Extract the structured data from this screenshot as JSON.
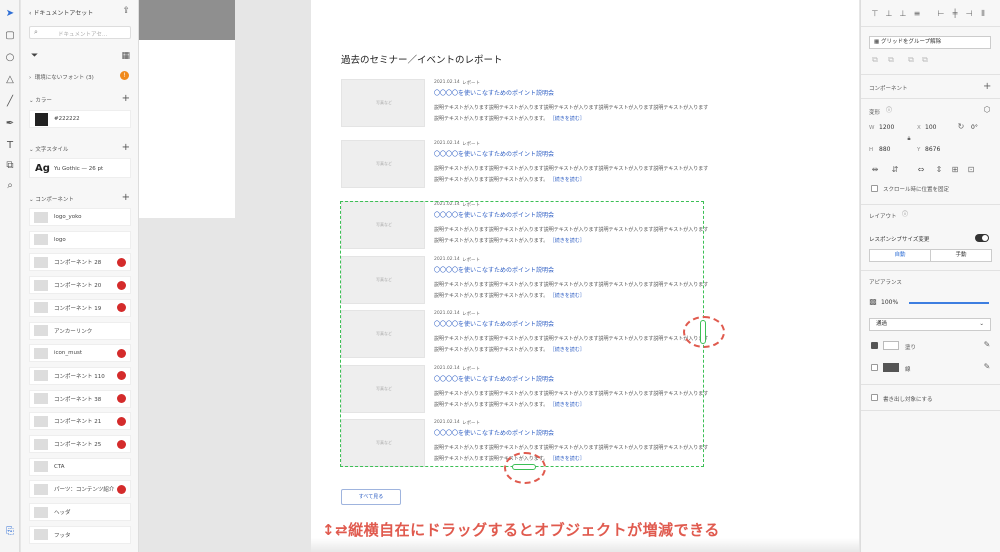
{
  "left_panel": {
    "back_label": "ドキュメントアセット",
    "search_placeholder": "ドキュメントアセ…",
    "missing_fonts": "環境にないフォント (3)",
    "colors_header": "カラー",
    "color_value": "#222222",
    "text_styles_header": "文字スタイル",
    "text_style_sample": "Ag",
    "text_style_value": "Yu Gothic — 26 pt",
    "components_header": "コンポーネント",
    "components": [
      {
        "name": "logo_yoko",
        "badge": false
      },
      {
        "name": "logo",
        "badge": false
      },
      {
        "name": "コンポーネント 28",
        "badge": true
      },
      {
        "name": "コンポーネント 20",
        "badge": true
      },
      {
        "name": "コンポーネント 19",
        "badge": true
      },
      {
        "name": "アンカーリンク",
        "badge": false
      },
      {
        "name": "icon_must",
        "badge": true
      },
      {
        "name": "コンポーネント 110",
        "badge": true
      },
      {
        "name": "コンポーネント 38",
        "badge": true
      },
      {
        "name": "コンポーネント 21",
        "badge": true
      },
      {
        "name": "コンポーネント 25",
        "badge": true
      },
      {
        "name": "CTA",
        "badge": false
      },
      {
        "name": "パーツ：コンテンツ紹介",
        "badge": true
      },
      {
        "name": "ヘッダ",
        "badge": false
      },
      {
        "name": "フッタ",
        "badge": false
      }
    ]
  },
  "canvas": {
    "page_title": "過去のセミナー／イベントのレポート",
    "articles": [
      {
        "date": "2021.02.14",
        "category": "レポート",
        "title": "〇〇〇〇を使いこなすためのポイント説明会",
        "desc": "説明テキストが入ります説明テキストが入ります説明テキストが入ります説明テキストが入ります説明テキストが入ります説明テキストが入ります説明テキストが入ります。",
        "more": "［続きを読む］",
        "thumb": "写真など"
      },
      {
        "date": "2021.02.14",
        "category": "レポート",
        "title": "〇〇〇〇を使いこなすためのポイント説明会",
        "desc": "説明テキストが入ります説明テキストが入ります説明テキストが入ります説明テキストが入ります説明テキストが入ります説明テキストが入ります説明テキストが入ります。",
        "more": "［続きを読む］",
        "thumb": "写真など"
      },
      {
        "date": "2021.02.14",
        "category": "レポート",
        "title": "〇〇〇〇を使いこなすためのポイント説明会",
        "desc": "説明テキストが入ります説明テキストが入ります説明テキストが入ります説明テキストが入ります説明テキストが入ります説明テキストが入ります説明テキストが入ります。",
        "more": "［続きを読む］",
        "thumb": "写真など"
      },
      {
        "date": "2021.02.14",
        "category": "レポート",
        "title": "〇〇〇〇を使いこなすためのポイント説明会",
        "desc": "説明テキストが入ります説明テキストが入ります説明テキストが入ります説明テキストが入ります説明テキストが入ります説明テキストが入ります説明テキストが入ります。",
        "more": "［続きを読む］",
        "thumb": "写真など"
      },
      {
        "date": "2021.02.14",
        "category": "レポート",
        "title": "〇〇〇〇を使いこなすためのポイント説明会",
        "desc": "説明テキストが入ります説明テキストが入ります説明テキストが入ります説明テキストが入ります説明テキストが入ります説明テキストが入ります説明テキストが入ります。",
        "more": "［続きを読む］",
        "thumb": "写真など"
      },
      {
        "date": "2021.02.14",
        "category": "レポート",
        "title": "〇〇〇〇を使いこなすためのポイント説明会",
        "desc": "説明テキストが入ります説明テキストが入ります説明テキストが入ります説明テキストが入ります説明テキストが入ります説明テキストが入ります説明テキストが入ります。",
        "more": "［続きを読む］",
        "thumb": "写真など"
      },
      {
        "date": "2021.02.14",
        "category": "レポート",
        "title": "〇〇〇〇を使いこなすためのポイント説明会",
        "desc": "説明テキストが入ります説明テキストが入ります説明テキストが入ります説明テキストが入ります説明テキストが入ります説明テキストが入ります説明テキストが入ります。",
        "more": "［続きを読む］",
        "thumb": "写真など"
      }
    ],
    "view_all": "すべて見る",
    "annotation": "↕⇄縦横自在にドラッグするとオブジェクトが増減できる"
  },
  "right_panel": {
    "ungroup_grid": "グリッドをグループ解除",
    "component_label": "コンポーネント",
    "transform_label": "変形",
    "w_label": "W",
    "w_value": "1200",
    "x_label": "X",
    "x_value": "100",
    "rotation_value": "0°",
    "h_label": "H",
    "h_value": "880",
    "y_label": "Y",
    "y_value": "8676",
    "fix_on_scroll": "スクロール時に位置を固定",
    "layout_label": "レイアウト",
    "responsive_resize": "レスポンシブサイズ変更",
    "auto_label": "自動",
    "manual_label": "手動",
    "appearance_label": "アピアランス",
    "opacity_value": "100%",
    "blend_mode": "通過",
    "fill_label": "塗り",
    "border_label": "線",
    "export_target": "書き出し対象にする"
  },
  "colors": {
    "accent_blue": "#2f5fc4",
    "badge_red": "#d42b2b",
    "annotation_red": "#e05a4e",
    "grid_green": "#3cbf55",
    "swatch": "#222222"
  }
}
